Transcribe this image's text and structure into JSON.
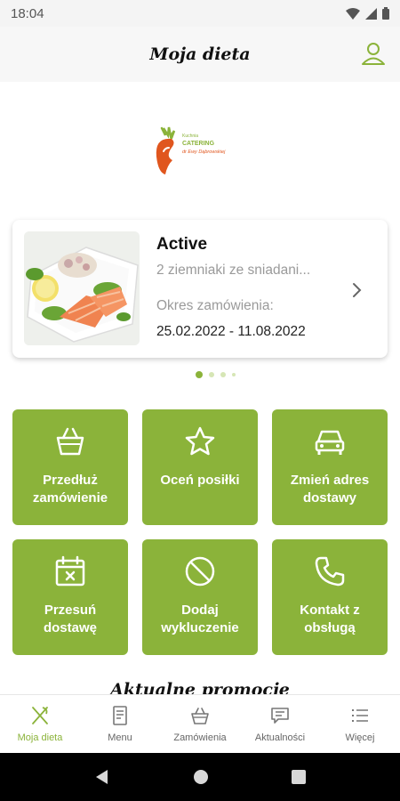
{
  "status_bar": {
    "time": "18:04",
    "icons": [
      "wifi-icon",
      "signal-icon",
      "battery-icon"
    ]
  },
  "header": {
    "title": "Moja dieta",
    "profile_icon": "user-icon"
  },
  "logo": {
    "small_text": "Kuchnia",
    "main_text": "CATERING",
    "sub_text": "dr Ewy Dąbrowskiej"
  },
  "order_card": {
    "title": "Active",
    "subtitle": "2 ziemniaki ze sniadani...",
    "period_label": "Okres zamówienia:",
    "period_value": "25.02.2022 - 11.08.2022"
  },
  "carousel": {
    "total": 4,
    "active_index": 0
  },
  "tiles": [
    {
      "label": "Przedłuż\nzamówienie",
      "icon": "basket-icon"
    },
    {
      "label": "Oceń posiłki",
      "icon": "star-icon"
    },
    {
      "label": "Zmień adres\ndostawy",
      "icon": "car-icon"
    },
    {
      "label": "Przesuń\ndostawę",
      "icon": "calendar-icon"
    },
    {
      "label": "Dodaj\nwykluczenie",
      "icon": "prohibited-icon"
    },
    {
      "label": "Kontakt z\nobsługą",
      "icon": "phone-icon"
    }
  ],
  "promotions": {
    "title": "Aktualne promocje"
  },
  "bottom_nav": {
    "items": [
      {
        "label": "Moja dieta",
        "icon": "cutlery-icon",
        "active": true
      },
      {
        "label": "Menu",
        "icon": "menu-document-icon",
        "active": false
      },
      {
        "label": "Zamówienia",
        "icon": "basket-icon",
        "active": false
      },
      {
        "label": "Aktualności",
        "icon": "news-icon",
        "active": false
      },
      {
        "label": "Więcej",
        "icon": "more-list-icon",
        "active": false
      }
    ]
  },
  "colors": {
    "accent": "#8bb33a",
    "accent_light": "#d6e6b5",
    "logo_orange": "#e0561e",
    "text_dark": "#111111",
    "text_muted": "#9a9a9a"
  }
}
